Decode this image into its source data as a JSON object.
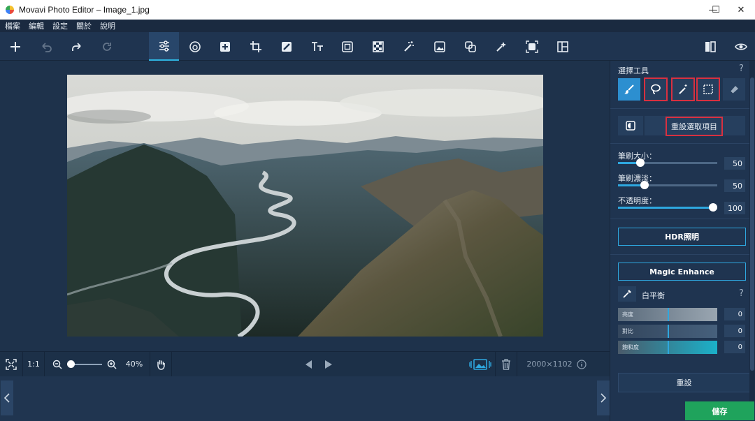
{
  "window": {
    "title": "Movavi Photo Editor – Image_1.jpg",
    "minimize": "—",
    "maximize": "☐",
    "close": "✕"
  },
  "menu": [
    "檔案",
    "編輯",
    "設定",
    "關於",
    "說明"
  ],
  "toolbar": {
    "left_icons": [
      "add-icon",
      "undo-icon",
      "redo-icon",
      "reset-icon"
    ],
    "tool_icons": [
      "adjust-icon",
      "filters-icon",
      "retouch-icon",
      "crop-icon",
      "object-removal-icon",
      "text-icon",
      "frame-icon",
      "background-icon",
      "magic-wand-icon",
      "insert-image-icon",
      "replace-background-icon",
      "enhance-icon",
      "restore-icon",
      "layout-icon"
    ],
    "right_icons": [
      "compare-icon",
      "preview-icon"
    ],
    "active_tool": "adjust-icon"
  },
  "bottombar": {
    "fit_label": "⛶",
    "one_to_one": "1:1",
    "zoom_percent": "40%",
    "zoom_level": 0.1,
    "image_size": "2000×1102"
  },
  "panel": {
    "select_tools_label": "選擇工具",
    "help": "?",
    "reset_selection_label": "重設選取項目",
    "brush_size_label": "筆刷大小：",
    "brush_size_value": "50",
    "brush_softness_label": "筆刷濃淡：",
    "brush_softness_value": "50",
    "opacity_label": "不透明度：",
    "opacity_value": "100",
    "hdr_label": "HDR照明",
    "magic_enhance_label": "Magic Enhance",
    "white_balance_label": "白平衡",
    "wb_brightness_label": "亮度",
    "wb_brightness_value": "0",
    "wb_contrast_label": "對比",
    "wb_contrast_value": "0",
    "wb_saturation_label": "飽和度",
    "wb_saturation_value": "0",
    "reset_label": "重設",
    "save_label": "儲存"
  },
  "colors": {
    "accent": "#2ea7df",
    "save_green": "#1fa35c",
    "highlight_red": "#d93040"
  }
}
